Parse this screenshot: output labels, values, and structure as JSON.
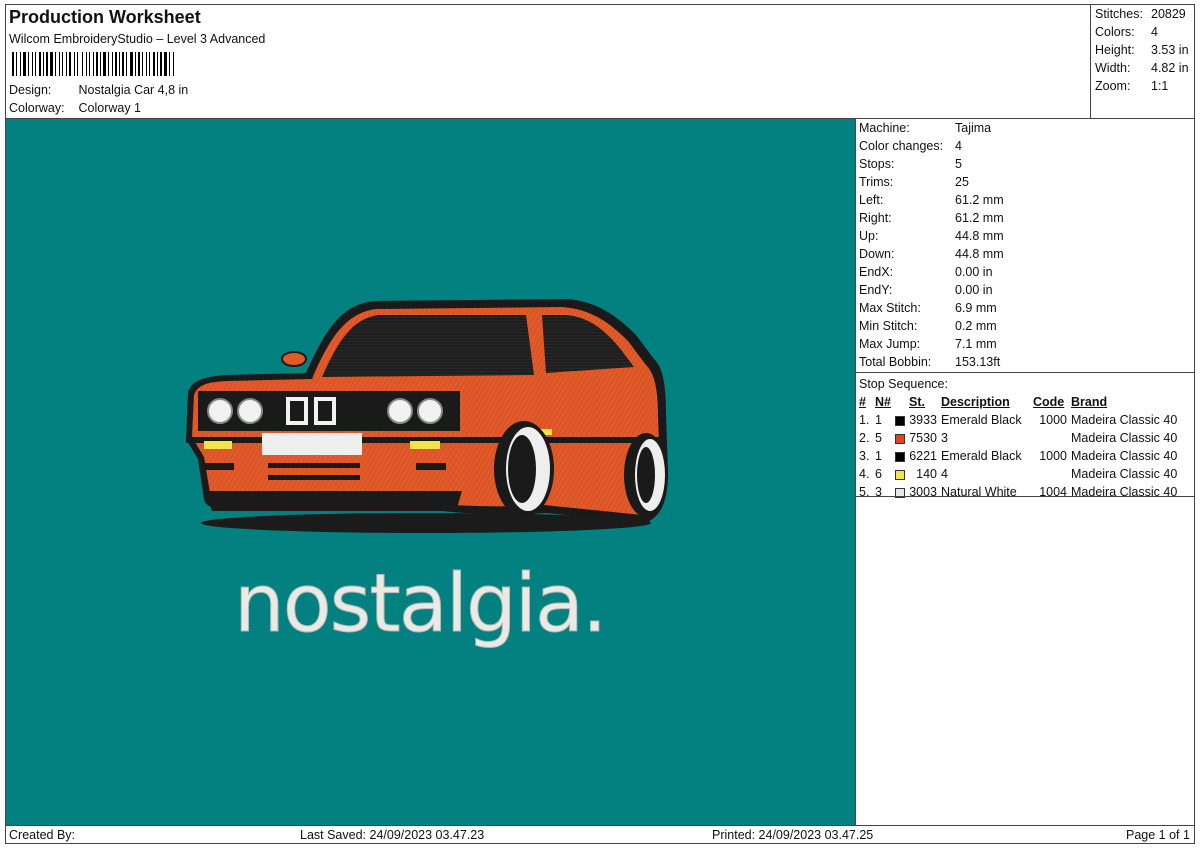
{
  "header": {
    "title": "Production Worksheet",
    "subtitle": "Wilcom EmbroideryStudio – Level 3 Advanced",
    "design_label": "Design:",
    "design_value": "Nostalgia Car 4,8 in",
    "colorway_label": "Colorway:",
    "colorway_value": "Colorway 1"
  },
  "stats": [
    {
      "label": "Stitches:",
      "value": "20829"
    },
    {
      "label": "Colors:",
      "value": "4"
    },
    {
      "label": "Height:",
      "value": "3.53 in"
    },
    {
      "label": "Width:",
      "value": "4.82 in"
    },
    {
      "label": "Zoom:",
      "value": "1:1"
    }
  ],
  "machine_info": [
    {
      "label": "Machine:",
      "value": "Tajima"
    },
    {
      "label": "Color changes:",
      "value": "4"
    },
    {
      "label": "Stops:",
      "value": "5"
    },
    {
      "label": "Trims:",
      "value": "25"
    },
    {
      "label": "Left:",
      "value": "61.2 mm"
    },
    {
      "label": "Right:",
      "value": "61.2 mm"
    },
    {
      "label": "Up:",
      "value": "44.8 mm"
    },
    {
      "label": "Down:",
      "value": "44.8 mm"
    },
    {
      "label": "EndX:",
      "value": "0.00 in"
    },
    {
      "label": "EndY:",
      "value": "0.00 in"
    },
    {
      "label": "Max Stitch:",
      "value": "6.9 mm"
    },
    {
      "label": "Min Stitch:",
      "value": "0.2 mm"
    },
    {
      "label": "Max Jump:",
      "value": "7.1 mm"
    },
    {
      "label": "Total Bobbin:",
      "value": "153.13ft"
    }
  ],
  "stop_sequence": {
    "title": "Stop Sequence:",
    "columns": {
      "num": "#",
      "n": "N#",
      "st": "St.",
      "description": "Description",
      "code": "Code",
      "brand": "Brand"
    },
    "rows": [
      {
        "num": "1.",
        "n": "1",
        "color": "#000000",
        "st": "3933",
        "description": "Emerald Black",
        "code": "1000",
        "brand": "Madeira Classic 40"
      },
      {
        "num": "2.",
        "n": "5",
        "color": "#e0441a",
        "st": "7530",
        "description": "3",
        "code": "",
        "brand": "Madeira Classic 40"
      },
      {
        "num": "3.",
        "n": "1",
        "color": "#000000",
        "st": "6221",
        "description": "Emerald Black",
        "code": "1000",
        "brand": "Madeira Classic 40"
      },
      {
        "num": "4.",
        "n": "6",
        "color": "#f0e64a",
        "st": "140",
        "description": "4",
        "code": "",
        "brand": "Madeira Classic 40"
      },
      {
        "num": "5.",
        "n": "3",
        "color": "#e8e8e8",
        "st": "3003",
        "description": "Natural White",
        "code": "1004",
        "brand": "Madeira Classic 40"
      }
    ]
  },
  "design_area": {
    "background": "#038181",
    "text": "nostalgia."
  },
  "footer": {
    "created_by": "Created By:",
    "last_saved": "Last Saved: 24/09/2023 03.47.23",
    "printed": "Printed: 24/09/2023 03.47.25",
    "page": "Page 1 of 1"
  }
}
